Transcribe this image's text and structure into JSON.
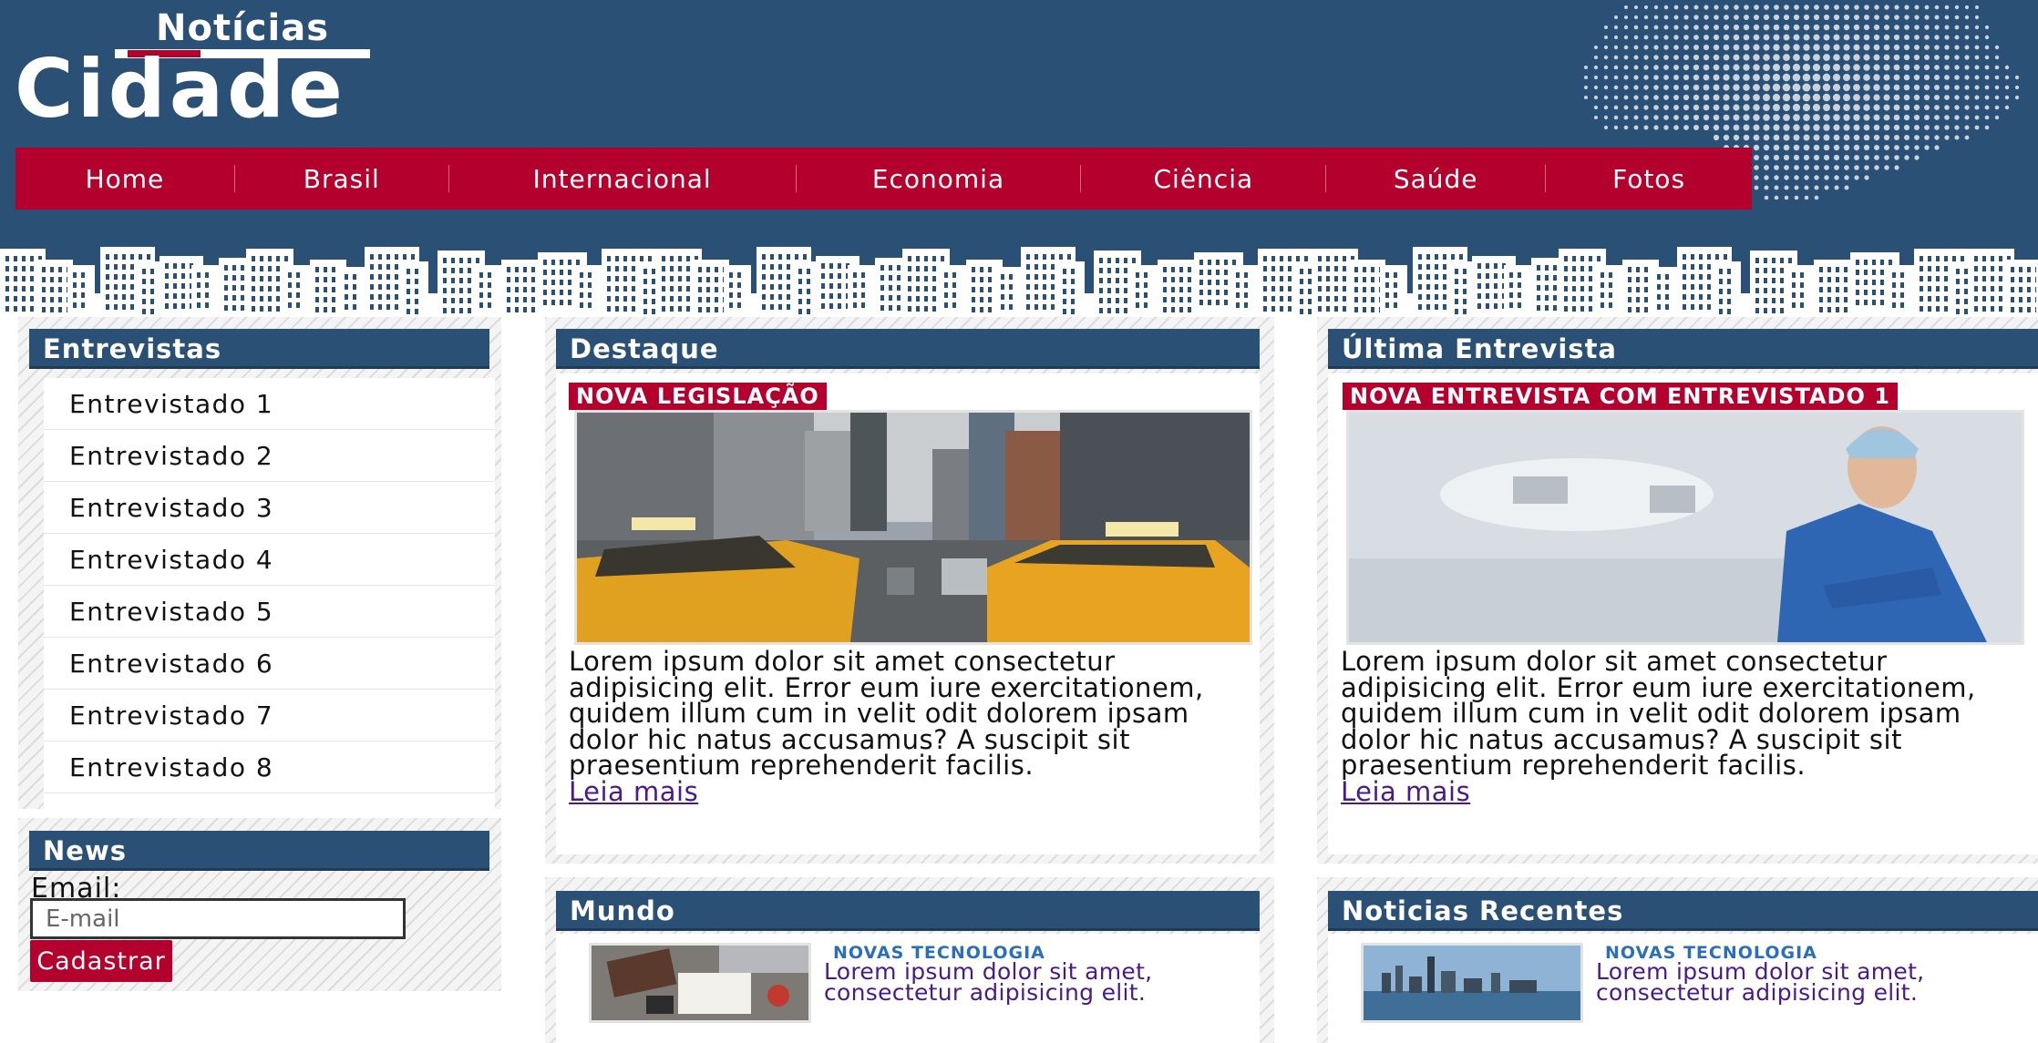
{
  "header": {
    "logo_top": "Notícias",
    "logo_main": "Cidade"
  },
  "nav": {
    "items": [
      {
        "label": "Home"
      },
      {
        "label": "Brasil"
      },
      {
        "label": "Internacional"
      },
      {
        "label": "Economia"
      },
      {
        "label": "Ciência"
      },
      {
        "label": "Saúde"
      },
      {
        "label": "Fotos"
      }
    ]
  },
  "colors": {
    "primary_blue": "#2b5076",
    "accent_red": "#b3002d",
    "link_purple": "#4a1a8a",
    "tag_blue": "#2b6fb8"
  },
  "sidebar": {
    "interviews_title": "Entrevistas",
    "interviews": [
      "Entrevistado 1",
      "Entrevistado 2",
      "Entrevistado 3",
      "Entrevistado 4",
      "Entrevistado 5",
      "Entrevistado 6",
      "Entrevistado 7",
      "Entrevistado 8"
    ],
    "news": {
      "title": "News",
      "email_label": "Email:",
      "email_placeholder": "E-mail",
      "submit_label": "Cadastrar"
    }
  },
  "featured": {
    "title": "Destaque",
    "tag": "NOVA LEGISLAÇÃO",
    "image": "city-street-taxis-photo",
    "text": "Lorem ipsum dolor sit amet consectetur adipisicing elit. Error eum iure exercitationem, quidem illum cum in velit odit dolorem ipsam dolor hic natus accusamus? A suscipit sit praesentium reprehenderit facilis.",
    "more": "Leia mais"
  },
  "last_interview": {
    "title": "Última Entrevista",
    "tag": "NOVA ENTREVISTA COM ENTREVISTADO 1",
    "image": "doctor-photo",
    "text": "Lorem ipsum dolor sit amet consectetur adipisicing elit. Error eum iure exercitationem, quidem illum cum in velit odit dolorem ipsam dolor hic natus accusamus? A suscipit sit praesentium reprehenderit facilis.",
    "more": "Leia mais"
  },
  "world": {
    "title": "Mundo",
    "items": [
      {
        "tag": "NOVAS TECNOLOGIA",
        "text": "Lorem ipsum dolor sit amet, consectetur adipisicing elit.",
        "image": "desk-workspace-photo"
      }
    ]
  },
  "recent": {
    "title": "Noticias Recentes",
    "items": [
      {
        "tag": "NOVAS TECNOLOGIA",
        "text": "Lorem ipsum dolor sit amet, consectetur adipisicing elit.",
        "image": "city-skyline-photo"
      }
    ]
  }
}
